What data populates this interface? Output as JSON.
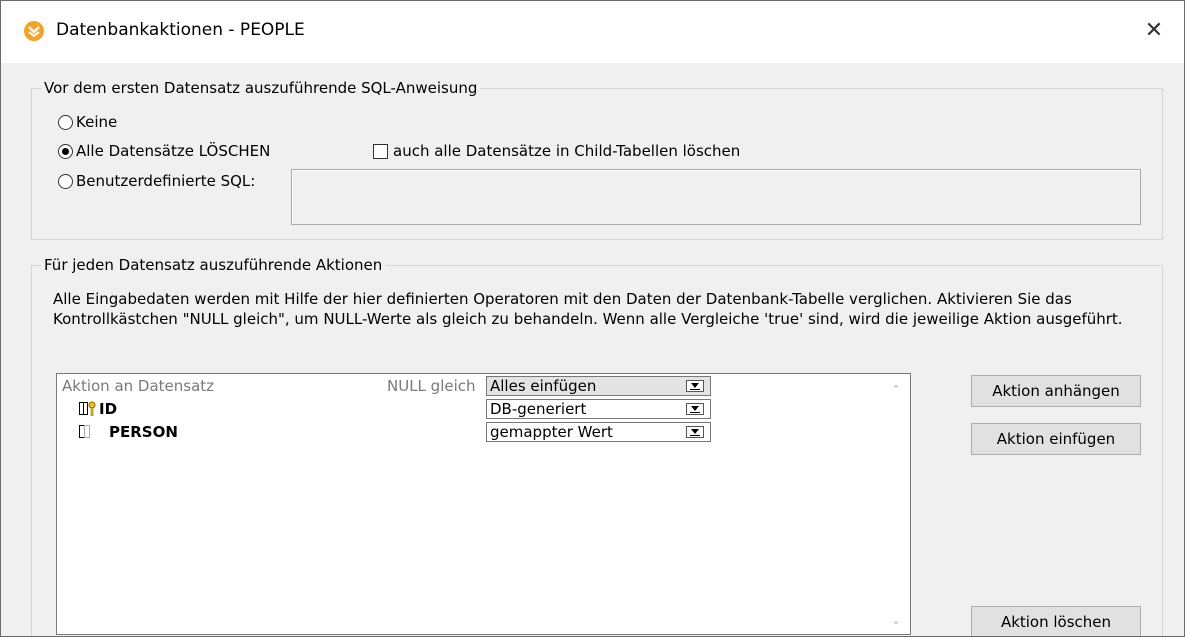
{
  "window": {
    "title": "Datenbankaktionen - PEOPLE",
    "close_glyph": "✕",
    "icon": "altova-app-icon"
  },
  "pre_sql": {
    "group_label": "Vor dem ersten Datensatz auszuführende SQL-Anweisung",
    "options": [
      {
        "label": "Keine",
        "selected": false
      },
      {
        "label": "Alle Datensätze LÖSCHEN",
        "selected": true
      },
      {
        "label": "Benutzerdefinierte SQL:",
        "selected": false
      }
    ],
    "child_tables_checkbox": {
      "label": "auch alle Datensätze in Child-Tabellen löschen",
      "checked": false
    },
    "custom_sql_value": ""
  },
  "actions": {
    "group_label": "Für jeden Datensatz auszuführende Aktionen",
    "description": "Alle Eingabedaten werden mit Hilfe der hier definierten Operatoren mit den Daten der Datenbank-Tabelle verglichen. Aktivieren Sie das Kontrollkästchen \"NULL gleich\", um NULL-Werte als gleich zu behandeln. Wenn alle Vergleiche 'true' sind, wird die jeweilige Aktion ausgeführt.",
    "grid": {
      "header_action": "Aktion an Datensatz",
      "header_null": "NULL gleich",
      "header_select": "Alles einfügen",
      "rows": [
        {
          "name": "ID",
          "icon": "primary-key-column-icon",
          "value": "DB-generiert"
        },
        {
          "name": "PERSON",
          "icon": "column-icon",
          "value": "gemappter Wert"
        }
      ]
    },
    "buttons": {
      "append": "Aktion anhängen",
      "insert": "Aktion einfügen",
      "delete": "Aktion löschen"
    }
  }
}
